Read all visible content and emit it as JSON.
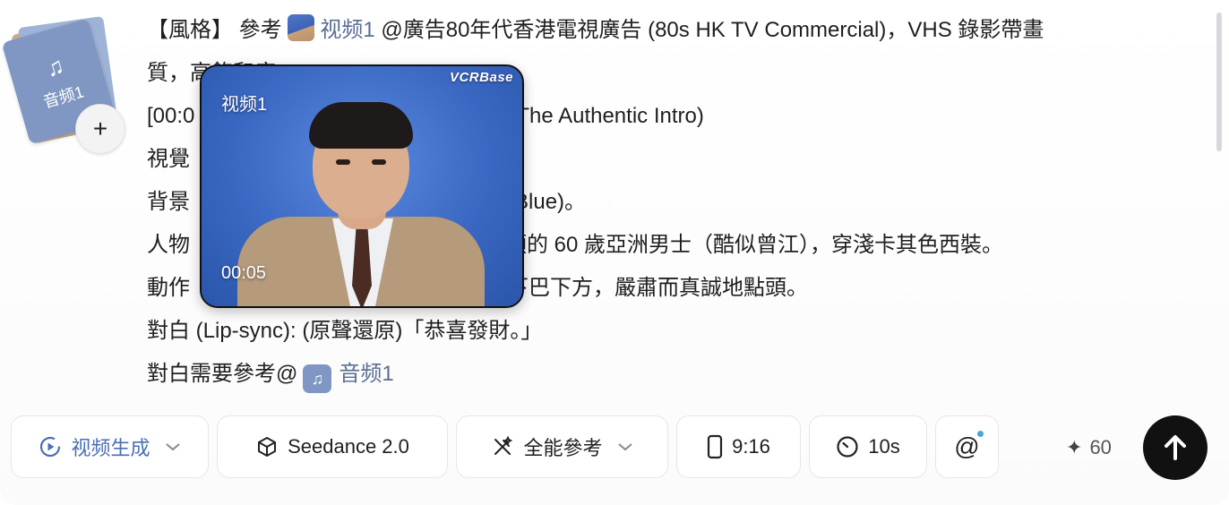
{
  "attachment": {
    "label": "音频1",
    "add_symbol": "+",
    "icon": "music-note-icon"
  },
  "prompt": {
    "line1_prefix": "【風格】 參考 ",
    "line1_ref": "视频1",
    "line1_suffix": " @廣告80年代香港電視廣告 (80s HK TV Commercial)，VHS 錄影帶畫",
    "line2": "質，高飽和度",
    "line3_start": "[00:0",
    "line3_end": "(The Authentic Intro)",
    "line4": "視覺",
    "line5_start": "背景",
    "line5_end": "Blue)。",
    "line6_start": "人物",
    "line6_end": "頭的 60 歲亞洲男士（酷似曾江），穿淺卡其色西裝。",
    "line7_start": "動作",
    "line7_end": "下巴下方，嚴肅而真誠地點頭。",
    "line8": "對白 (Lip-sync): (原聲還原)「恭喜發財。」",
    "line9_prefix": "對白需要參考@",
    "line9_ref": "音频1"
  },
  "preview": {
    "label": "视频1",
    "time": "00:05",
    "watermark": "VCRBase"
  },
  "toolbar": {
    "mode_label": "视频生成",
    "model_label": "Seedance 2.0",
    "reference_label": "全能參考",
    "ratio_label": "9:16",
    "duration_label": "10s",
    "mention_symbol": "@",
    "credits": "60"
  },
  "colors": {
    "accent": "#4a6fb5",
    "send_bg": "#111111",
    "audio_chip": "#7f97c2"
  }
}
